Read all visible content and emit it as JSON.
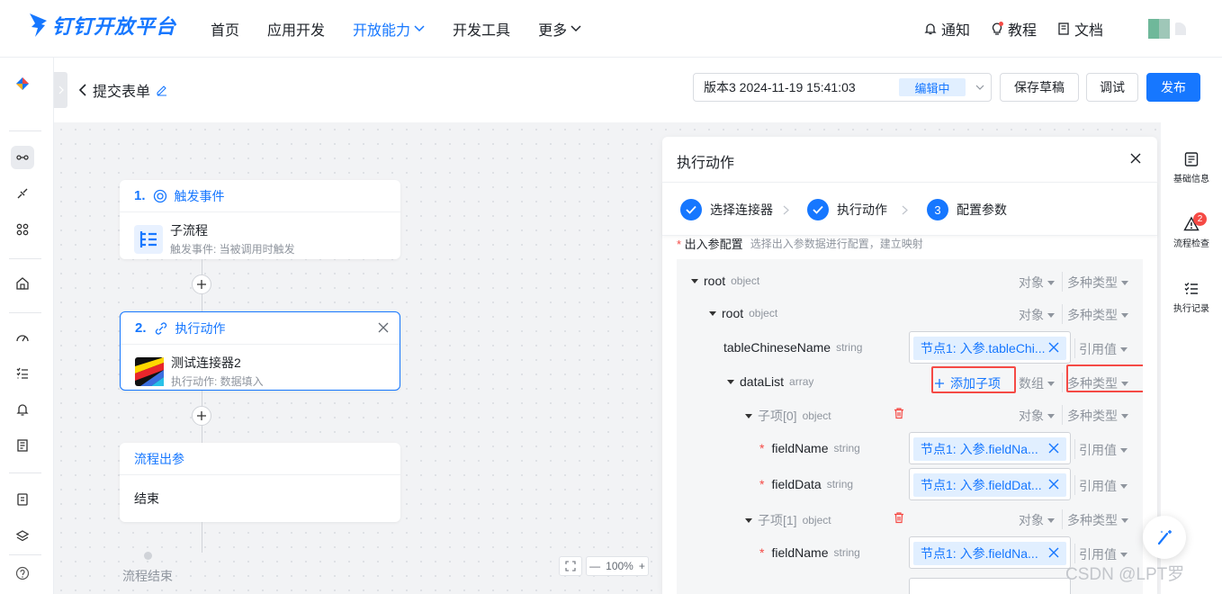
{
  "nav": {
    "logo_text": "钉钉开放平台",
    "items": [
      {
        "label": "首页",
        "active": false
      },
      {
        "label": "应用开发",
        "active": false
      },
      {
        "label": "开放能力",
        "active": true,
        "dropdown": true
      },
      {
        "label": "开发工具",
        "active": false
      },
      {
        "label": "更多",
        "active": false,
        "dropdown": true
      }
    ],
    "right": [
      {
        "label": "通知",
        "icon": "bell-icon"
      },
      {
        "label": "教程",
        "icon": "lightbulb-icon"
      },
      {
        "label": "文档",
        "icon": "document-icon"
      }
    ]
  },
  "header": {
    "title": "提交表单",
    "version": "版本3 2024-11-19 15:41:03",
    "version_status": "编辑中",
    "save_draft": "保存草稿",
    "debug": "调试",
    "publish": "发布"
  },
  "flow": {
    "trigger": {
      "num": "1.",
      "title": "触发事件",
      "name": "子流程",
      "desc": "触发事件: 当被调用时触发"
    },
    "action": {
      "num": "2.",
      "title": "执行动作",
      "name": "测试连接器2",
      "desc": "执行动作: 数据填入"
    },
    "output": {
      "title": "流程出参",
      "body": "结束"
    },
    "end_label": "流程结束",
    "zoom": "100%"
  },
  "panel": {
    "title": "执行动作",
    "steps": [
      {
        "label": "选择连接器",
        "state": "done"
      },
      {
        "label": "执行动作",
        "state": "done"
      },
      {
        "label": "配置参数",
        "state": "current",
        "num": "3"
      }
    ],
    "section_title": "出入参配置",
    "section_hint": "选择出入参数据进行配置，建立映射",
    "rows": [
      {
        "name": "root",
        "type": "object",
        "dd1": "对象",
        "dd2": "多种类型"
      },
      {
        "name": "root",
        "type": "object",
        "dd1": "对象",
        "dd2": "多种类型"
      },
      {
        "name": "tableChineseName",
        "type": "string",
        "ref": "节点1: 入参.tableChi...",
        "ref_mode": "引用值"
      },
      {
        "name": "dataList",
        "type": "array",
        "add_label": "添加子项",
        "dd1": "数组",
        "dd2": "多种类型"
      },
      {
        "name": "子项[0]",
        "type": "object",
        "dd1": "对象",
        "dd2": "多种类型"
      },
      {
        "name": "fieldName",
        "type": "string",
        "ref": "节点1: 入参.fieldNa...",
        "ref_mode": "引用值"
      },
      {
        "name": "fieldData",
        "type": "string",
        "ref": "节点1: 入参.fieldDat...",
        "ref_mode": "引用值"
      },
      {
        "name": "子项[1]",
        "type": "object",
        "dd1": "对象",
        "dd2": "多种类型"
      },
      {
        "name": "fieldName",
        "type": "string",
        "ref": "节点1: 入参.fieldNa...",
        "ref_mode": "引用值"
      }
    ]
  },
  "right_sidebar": [
    {
      "label": "基础信息",
      "icon": "info-doc-icon"
    },
    {
      "label": "流程检查",
      "icon": "warning-icon",
      "badge": "2"
    },
    {
      "label": "执行记录",
      "icon": "checklist-icon"
    }
  ],
  "watermark": "CSDN @LPT罗",
  "colors": {
    "accent": "#1677ff",
    "danger": "#f54a45",
    "tag_bg": "#e1efff"
  }
}
